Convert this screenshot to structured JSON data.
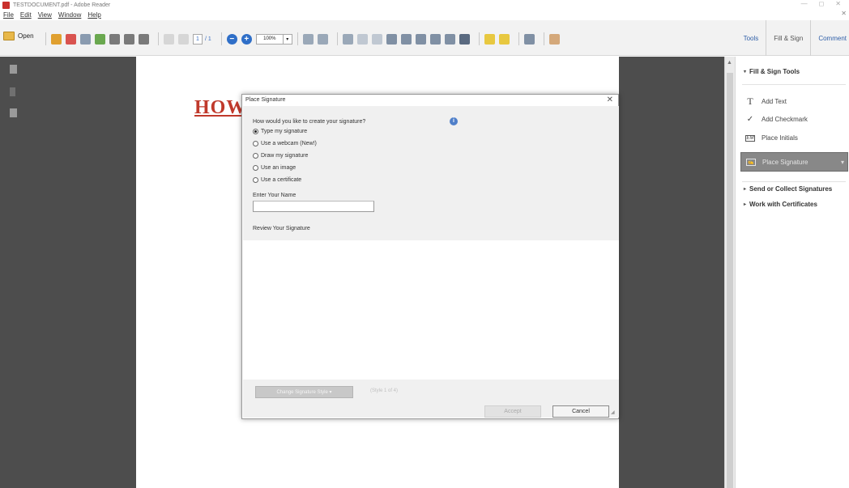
{
  "window": {
    "title": "TESTDOCUMENT.pdf - Adobe Reader",
    "controls": [
      "—",
      "◻",
      "✕"
    ]
  },
  "menubar": {
    "items": [
      "File",
      "Edit",
      "View",
      "Window",
      "Help"
    ],
    "close": "✕"
  },
  "toolbar": {
    "open_label": "Open",
    "page_current": "1",
    "page_total": "/ 1",
    "zoom_out": "−",
    "zoom_in": "+",
    "zoom_value": "100%",
    "zoom_dropdown": "▾",
    "tabs": {
      "tools": "Tools",
      "fill_sign": "Fill & Sign",
      "comment": "Comment"
    }
  },
  "document": {
    "heading": "HOW"
  },
  "right_pane": {
    "fill_sign_tools": "Fill & Sign Tools",
    "add_text": "Add Text",
    "add_text_icon": "T",
    "add_checkmark": "Add Checkmark",
    "add_checkmark_icon": "✓",
    "place_initials": "Place Initials",
    "place_initials_icon": "EM",
    "place_signature": "Place Signature",
    "place_signature_icon": "✍",
    "place_signature_dropdown": "▾",
    "send_collect": "Send or Collect Signatures",
    "work_certificates": "Work with Certificates",
    "collapse_arrow": "▾",
    "expand_arrow": "▸"
  },
  "scrollbar": {
    "up_arrow": "▲"
  },
  "dialog": {
    "title": "Place Signature",
    "close": "✕",
    "question": "How would you like to create your signature?",
    "help_icon": "i",
    "options": [
      {
        "label": "Type my signature",
        "checked": true
      },
      {
        "label": "Use a webcam (New!)",
        "checked": false
      },
      {
        "label": "Draw my signature",
        "checked": false
      },
      {
        "label": "Use an image",
        "checked": false
      },
      {
        "label": "Use a certificate",
        "checked": false
      }
    ],
    "name_label": "Enter Your Name",
    "name_value": "",
    "review_label": "Review Your Signature",
    "change_style_button": "Change Signature Style ▾",
    "style_hint": "(Style 1 of 4)",
    "accept_button": "Accept",
    "cancel_button": "Cancel",
    "grip": "◢"
  },
  "colors": {
    "heading_red": "#c0392b",
    "doc_bg": "#4d4d4d",
    "accent_blue": "#2f5fa8",
    "place_signature_bg": "#888888"
  }
}
